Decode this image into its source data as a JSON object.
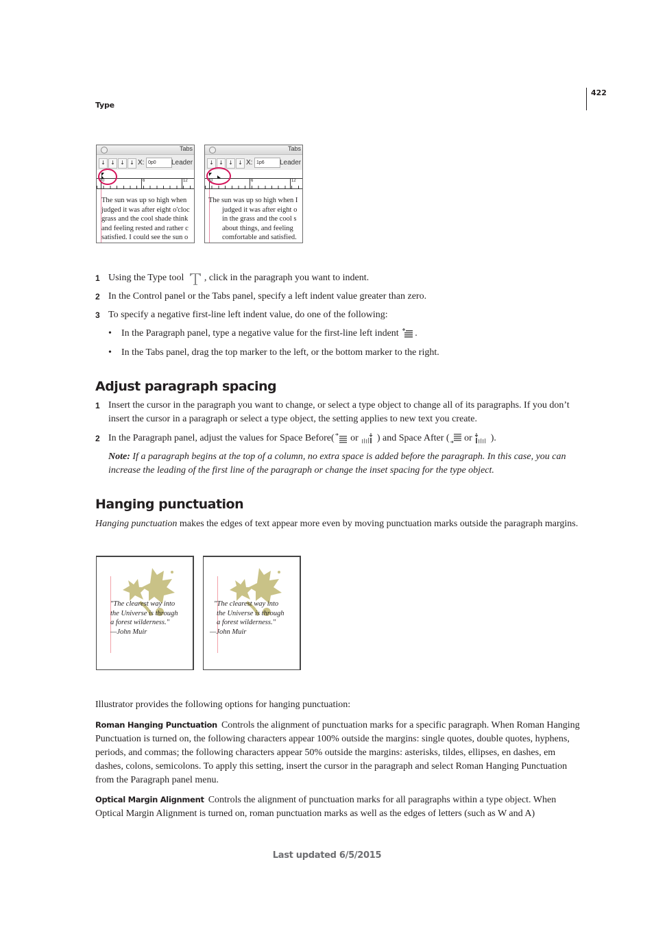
{
  "header": {
    "section": "Type",
    "page_number": "422"
  },
  "figure_tabs": [
    {
      "panel_title": "Tabs",
      "x_label": "X:",
      "x_value": "0p0",
      "leader_label": "Leader",
      "ruler_labels": [
        "0",
        "6",
        "12"
      ],
      "text_lines": [
        "The sun was up so high when",
        "judged it was after eight o'cloc",
        "grass and the cool shade think",
        "and feeling rested and rather c",
        "satisfied. I could see the sun o"
      ]
    },
    {
      "panel_title": "Tabs",
      "x_label": "X:",
      "x_value": "1p6",
      "leader_label": "Leader",
      "ruler_labels": [
        "0",
        "6",
        "12"
      ],
      "text_lines": [
        "The sun was up so high when I",
        "judged it was after eight o",
        "in the grass and the cool s",
        "about things, and feeling",
        "comfortable and satisfied."
      ]
    }
  ],
  "steps_indent": [
    {
      "num": "1",
      "before": "Using the Type tool",
      "icon": "type-tool-icon",
      "after": ", click in the paragraph you want to indent."
    },
    {
      "num": "2",
      "text": "In the Control panel or the Tabs panel, specify a left indent value greater than zero."
    },
    {
      "num": "3",
      "text": "To specify a negative first-line left indent value, do one of the following:"
    }
  ],
  "bullets_indent": [
    {
      "text": "In the Paragraph panel, type a negative value for the first-line left indent",
      "icon": "first-line-indent-icon",
      "suffix": "."
    },
    {
      "text": "In the Tabs panel, drag the top marker to the left, or the bottom marker to the right."
    }
  ],
  "section_spacing": {
    "heading": "Adjust paragraph spacing",
    "steps": [
      {
        "num": "1",
        "text": "Insert the cursor in the paragraph you want to change, or select a type object to change all of its paragraphs. If you don’t insert the cursor in a paragraph or select a type object, the setting applies to new text you create."
      },
      {
        "num": "2",
        "before": "In the Paragraph panel, adjust the values for Space Before(",
        "or1": " or ",
        "mid": " ) and Space After (",
        "or2": " or ",
        "end": " )."
      }
    ],
    "note_label": "Note:",
    "note_text": " If a paragraph begins at the top of a column, no extra space is added before the paragraph. In this case, you can increase the leading of the first line of the paragraph or change the inset spacing for the type object."
  },
  "section_hanging": {
    "heading": "Hanging punctuation",
    "intro_term": "Hanging punctuation",
    "intro_text": " makes the edges of text appear more even by moving punctuation marks outside the paragraph margins.",
    "figure_quote": [
      "\"The clearest way into",
      "the Universe is through",
      "a forest wilderness.\"",
      "—John Muir"
    ],
    "options_intro": "Illustrator provides the following options for hanging punctuation:",
    "options": [
      {
        "term": "Roman Hanging Punctuation",
        "text": "Controls the alignment of punctuation marks for a specific paragraph. When Roman Hanging Punctuation is turned on, the following characters appear 100% outside the margins: single quotes, double quotes, hyphens, periods, and commas; the following characters appear 50% outside the margins: asterisks, tildes, ellipses, en dashes, em dashes, colons, semicolons. To apply this setting, insert the cursor in the paragraph and select Roman Hanging Punctuation from the Paragraph panel menu."
      },
      {
        "term": "Optical Margin Alignment",
        "text": "Controls the alignment of punctuation marks for all paragraphs within a type object. When Optical Margin Alignment is turned on, roman punctuation marks as well as the edges of letters (such as W and A)"
      }
    ]
  },
  "footer": {
    "text": "Last updated 6/5/2015"
  },
  "colors": {
    "highlight_circle": "#d4145a",
    "margin_guide": "#e58aa3",
    "leaf": "#c9c287",
    "footer_text": "#6d6e71"
  }
}
